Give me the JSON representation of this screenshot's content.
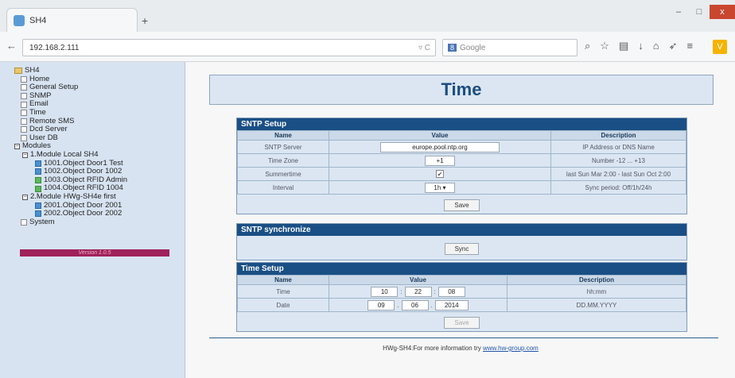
{
  "browser": {
    "tab_title": "SH4",
    "new_tab": "+",
    "url": "192.168.2.111",
    "url_tail": "▿ C",
    "search_placeholder": "Google",
    "search_engine_badge": "8",
    "win_min": "–",
    "win_max": "□",
    "win_close": "x",
    "ext_label": "V",
    "icons": [
      "search-icon",
      "star-icon",
      "clipboard-icon",
      "download-icon",
      "home-icon",
      "send-icon",
      "menu-icon"
    ]
  },
  "tree": {
    "root": "SH4",
    "items": [
      "Home",
      "General Setup",
      "SNMP",
      "Email",
      "Time",
      "Remote SMS",
      "Dcd Server",
      "User DB"
    ],
    "modules_label": "Modules",
    "module1": "1.Module Local SH4",
    "module1_items": [
      "1001.Object Door1 Test",
      "1002.Object Door 1002",
      "1003.Object RFID Admin",
      "1004.Object RFID 1004"
    ],
    "module2": "2.Module HWg-SH4e first",
    "module2_items": [
      "2001.Object Door 2001",
      "2002.Object Door 2002"
    ],
    "system": "System",
    "version": "Version 1.0.5"
  },
  "page": {
    "title": "Time"
  },
  "sntp_setup": {
    "header": "SNTP Setup",
    "columns": [
      "Name",
      "Value",
      "Description"
    ],
    "rows": [
      {
        "name": "SNTP Server",
        "value": "europe.pool.ntp.org",
        "desc": "IP Address or DNS Name"
      },
      {
        "name": "Time Zone",
        "value": "+1",
        "desc": "Number -12 ... +13"
      },
      {
        "name": "Summertime",
        "value": "✔",
        "desc": "last Sun Mar 2:00 - last Sun Oct 2:00"
      },
      {
        "name": "Interval",
        "value": "1h ▾",
        "desc": "Sync period: Off/1h/24h"
      }
    ],
    "save": "Save"
  },
  "sntp_sync": {
    "header": "SNTP synchronize",
    "sync": "Sync"
  },
  "time_setup": {
    "header": "Time Setup",
    "columns": [
      "Name",
      "Value",
      "Description"
    ],
    "time": {
      "name": "Time",
      "h": "10",
      "m": "22",
      "s": "08",
      "sep": ":",
      "desc": "hh:mm"
    },
    "date": {
      "name": "Date",
      "d": "09",
      "mo": "06",
      "y": "2014",
      "sep": ".",
      "desc": "DD.MM.YYYY"
    },
    "save": "Save"
  },
  "footer": {
    "text": "HWg-SH4:For more information try",
    "link": "www.hw-group.com"
  }
}
